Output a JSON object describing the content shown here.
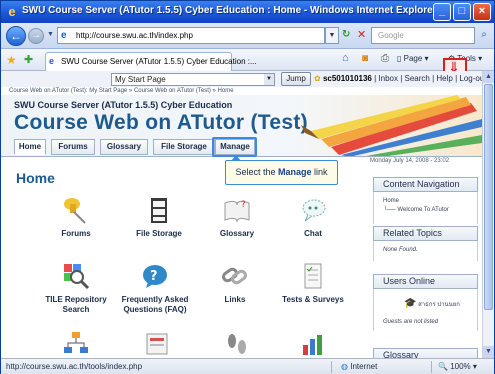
{
  "window": {
    "title": "SWU Course Server (ATutor 1.5.5) Cyber Education : Home - Windows Internet Explorer"
  },
  "addressbar": {
    "url": "http://course.swu.ac.th/index.php",
    "search_placeholder": "Google"
  },
  "commandbar": {
    "tab_label": "SWU Course Server (ATutor 1.5.5) Cyber Education :...",
    "page_label": "Page",
    "tools_label": "Tools"
  },
  "page": {
    "jump_select": "My Start Page",
    "jump_button": "Jump",
    "user_bar": {
      "username": "sc501010136",
      "links": "| Inbox | Search | Help | Log-out"
    },
    "breadcrumb": "Course Web on ATutor (Test): My Start Page » Course Web on ATutor (Test) » Home",
    "site_name": "SWU Course Server (ATutor 1.5.5) Cyber Education",
    "course_title": "Course Web on ATutor (Test)",
    "tabs": [
      "Home",
      "Forums",
      "Glossary",
      "File Storage",
      "Manage"
    ],
    "callout": {
      "prefix": "Select the ",
      "strong": "Manage",
      "suffix": " link"
    },
    "date": "Monday July 14, 2008 - 23:02",
    "home_heading": "Home",
    "tools": [
      {
        "label": "Forums",
        "icon": "pushpin-icon"
      },
      {
        "label": "File Storage",
        "icon": "file-cabinet-icon"
      },
      {
        "label": "Glossary",
        "icon": "book-icon"
      },
      {
        "label": "Chat",
        "icon": "chat-icon"
      },
      {
        "label": "TILE Repository Search",
        "icon": "magnifier-icon"
      },
      {
        "label": "Frequently Asked Questions (FAQ)",
        "icon": "question-icon"
      },
      {
        "label": "Links",
        "icon": "chain-icon"
      },
      {
        "label": "Tests & Surveys",
        "icon": "checklist-icon"
      },
      {
        "label": "",
        "icon": "sitemap-icon"
      },
      {
        "label": "",
        "icon": "web-icon"
      },
      {
        "label": "",
        "icon": "footprints-icon"
      },
      {
        "label": "",
        "icon": "bar-chart-icon"
      }
    ],
    "sidebar": {
      "content_navigation": {
        "heading": "Content Navigation",
        "home": "Home",
        "item": "Welcome To ATutor"
      },
      "related_topics": {
        "heading": "Related Topics",
        "text": "None Found."
      },
      "users_online": {
        "heading": "Users Online",
        "user": "สาธกร ปานนยก",
        "guests": "Guests are not listed"
      },
      "next_heading": "Glossary"
    }
  },
  "statusbar": {
    "url": "http://course.swu.ac.th/tools/index.php",
    "zone": "Internet",
    "zoom": "100%"
  }
}
